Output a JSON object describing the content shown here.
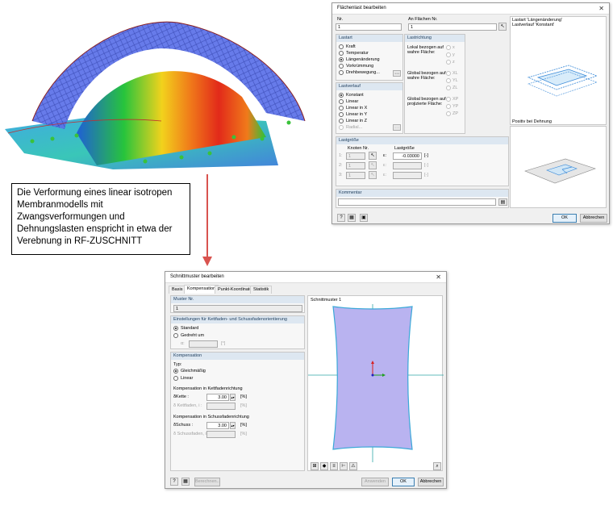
{
  "callout": {
    "lines": [
      "Die Verformung eines linear isotropen",
      "Membranmodells mit",
      "Zwangsverformungen und",
      "Dehnungslasten enspricht in etwa der",
      "Verebnung in RF-ZUSCHNITT"
    ]
  },
  "flaechenlast": {
    "title": "Flächenlast bearbeiten",
    "nr_label": "Nr.",
    "nr_value": "1",
    "flaechen_label": "An Flächen Nr.",
    "flaechen_value": "1",
    "lastart": {
      "header": "Lastart",
      "options": [
        "Kraft",
        "Temperatur",
        "Längenänderung",
        "Vorkrümmung",
        "Drehbewegung..."
      ],
      "selected": 2
    },
    "lastrichtung": {
      "header": "Lastrichtung",
      "groups": [
        {
          "label1": "Lokal bezogen auf",
          "label2": "wahre Fläche:",
          "axes": [
            "x",
            "y",
            "z"
          ]
        },
        {
          "label1": "Global bezogen auf",
          "label2": "wahre Fläche:",
          "axes": [
            "XL",
            "YL",
            "ZL"
          ]
        },
        {
          "label1": "Global bezogen auf",
          "label2": "projizierte Fläche:",
          "axes": [
            "XP",
            "YP",
            "ZP"
          ]
        }
      ]
    },
    "lastverlauf": {
      "header": "Lastverlauf",
      "options": [
        "Konstant",
        "Linear",
        "Linear in X",
        "Linear in Y",
        "Linear in Z",
        "Radial..."
      ],
      "selected": 0
    },
    "preview_top_text1": "Lastart 'Längenänderung'",
    "preview_top_text2": "Lastverlauf 'Konstant'",
    "preview_caption": "Positiv bei Dehnung",
    "lastgroesse": {
      "header": "Lastgröße",
      "knoten_label": "Knoten Nr.",
      "lastgroesse_label": "Lastgröße",
      "rows": [
        {
          "n": "1:",
          "k": "1",
          "sym": "ε:",
          "val": "-0.03000",
          "unit": "[-]"
        },
        {
          "n": "2:",
          "k": "1",
          "sym": "ε:",
          "val": "",
          "unit": "[-]"
        },
        {
          "n": "3:",
          "k": "1",
          "sym": "ε:",
          "val": "",
          "unit": "[-]"
        }
      ]
    },
    "kommentar_header": "Kommentar",
    "ok": "OK",
    "abbrechen": "Abbrechen"
  },
  "schnittmuster": {
    "title": "Schnittmuster bearbeiten",
    "tabs": [
      "Basis",
      "Kompensation",
      "Punkt-Koordinaten",
      "Statistik"
    ],
    "active_tab": 1,
    "muster_header": "Muster Nr.",
    "muster_value": "1",
    "einstellungen_header": "Einstellungen für Kettfaden- und Schussfadenorientierung",
    "orient_options": [
      "Standard",
      "Gedreht um"
    ],
    "orient_selected": 0,
    "alpha_label": "α:",
    "alpha_unit": "[°]",
    "kompensation_header": "Kompensation",
    "typ_label": "Typ:",
    "typ_options": [
      "Gleichmäßig",
      "Linear"
    ],
    "typ_selected": 0,
    "kett_label": "Kompensation in Kettfadenrichtung",
    "kett_sym": "δKette :",
    "kett_value": "3.00",
    "kett_unit": "[%]",
    "kett_dim_sym": "δ Kettfaden, i :",
    "kett_dim_unit": "[%]",
    "schuss_label": "Kompensation in Schussfadenrichtung",
    "schuss_sym": "δSchuss :",
    "schuss_value": "3.00",
    "schuss_unit": "[%]",
    "schuss_dim_sym": "δ Schussfaden, i :",
    "schuss_dim_unit": "[%]",
    "preview_label": "Schnittmuster 1",
    "berechnen": "Berechnen...",
    "anwenden": "Anwenden",
    "ok": "OK",
    "abbrechen": "Abbrechen"
  }
}
